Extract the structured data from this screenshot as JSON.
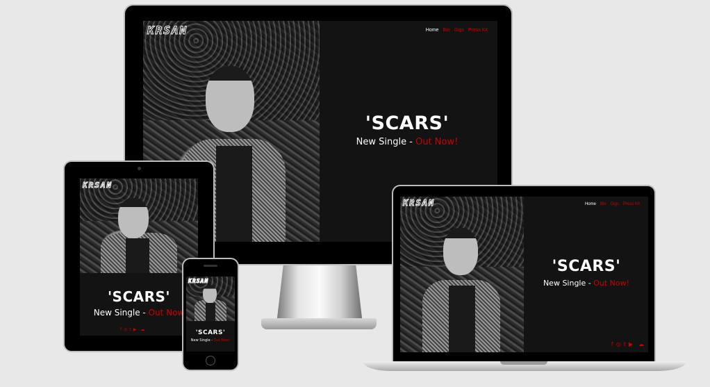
{
  "site": {
    "logo": "KRSAN",
    "nav": [
      "Home",
      "Bio",
      "Gigs",
      "Press Kit"
    ],
    "headline": "'SCARS'",
    "sub_prefix": "New Single - ",
    "sub_highlight": "Out Now!",
    "sub_highlight_tablet": "Out Now",
    "social_icons": [
      "facebook-icon",
      "instagram-icon",
      "twitter-icon",
      "youtube-icon",
      "apple-icon",
      "soundcloud-icon"
    ],
    "social_glyphs": [
      "f",
      "◎",
      "t",
      "▶",
      "",
      "☁"
    ]
  },
  "colors": {
    "accent": "#cc0000",
    "panel": "#131313",
    "background": "#e8e8e8"
  }
}
